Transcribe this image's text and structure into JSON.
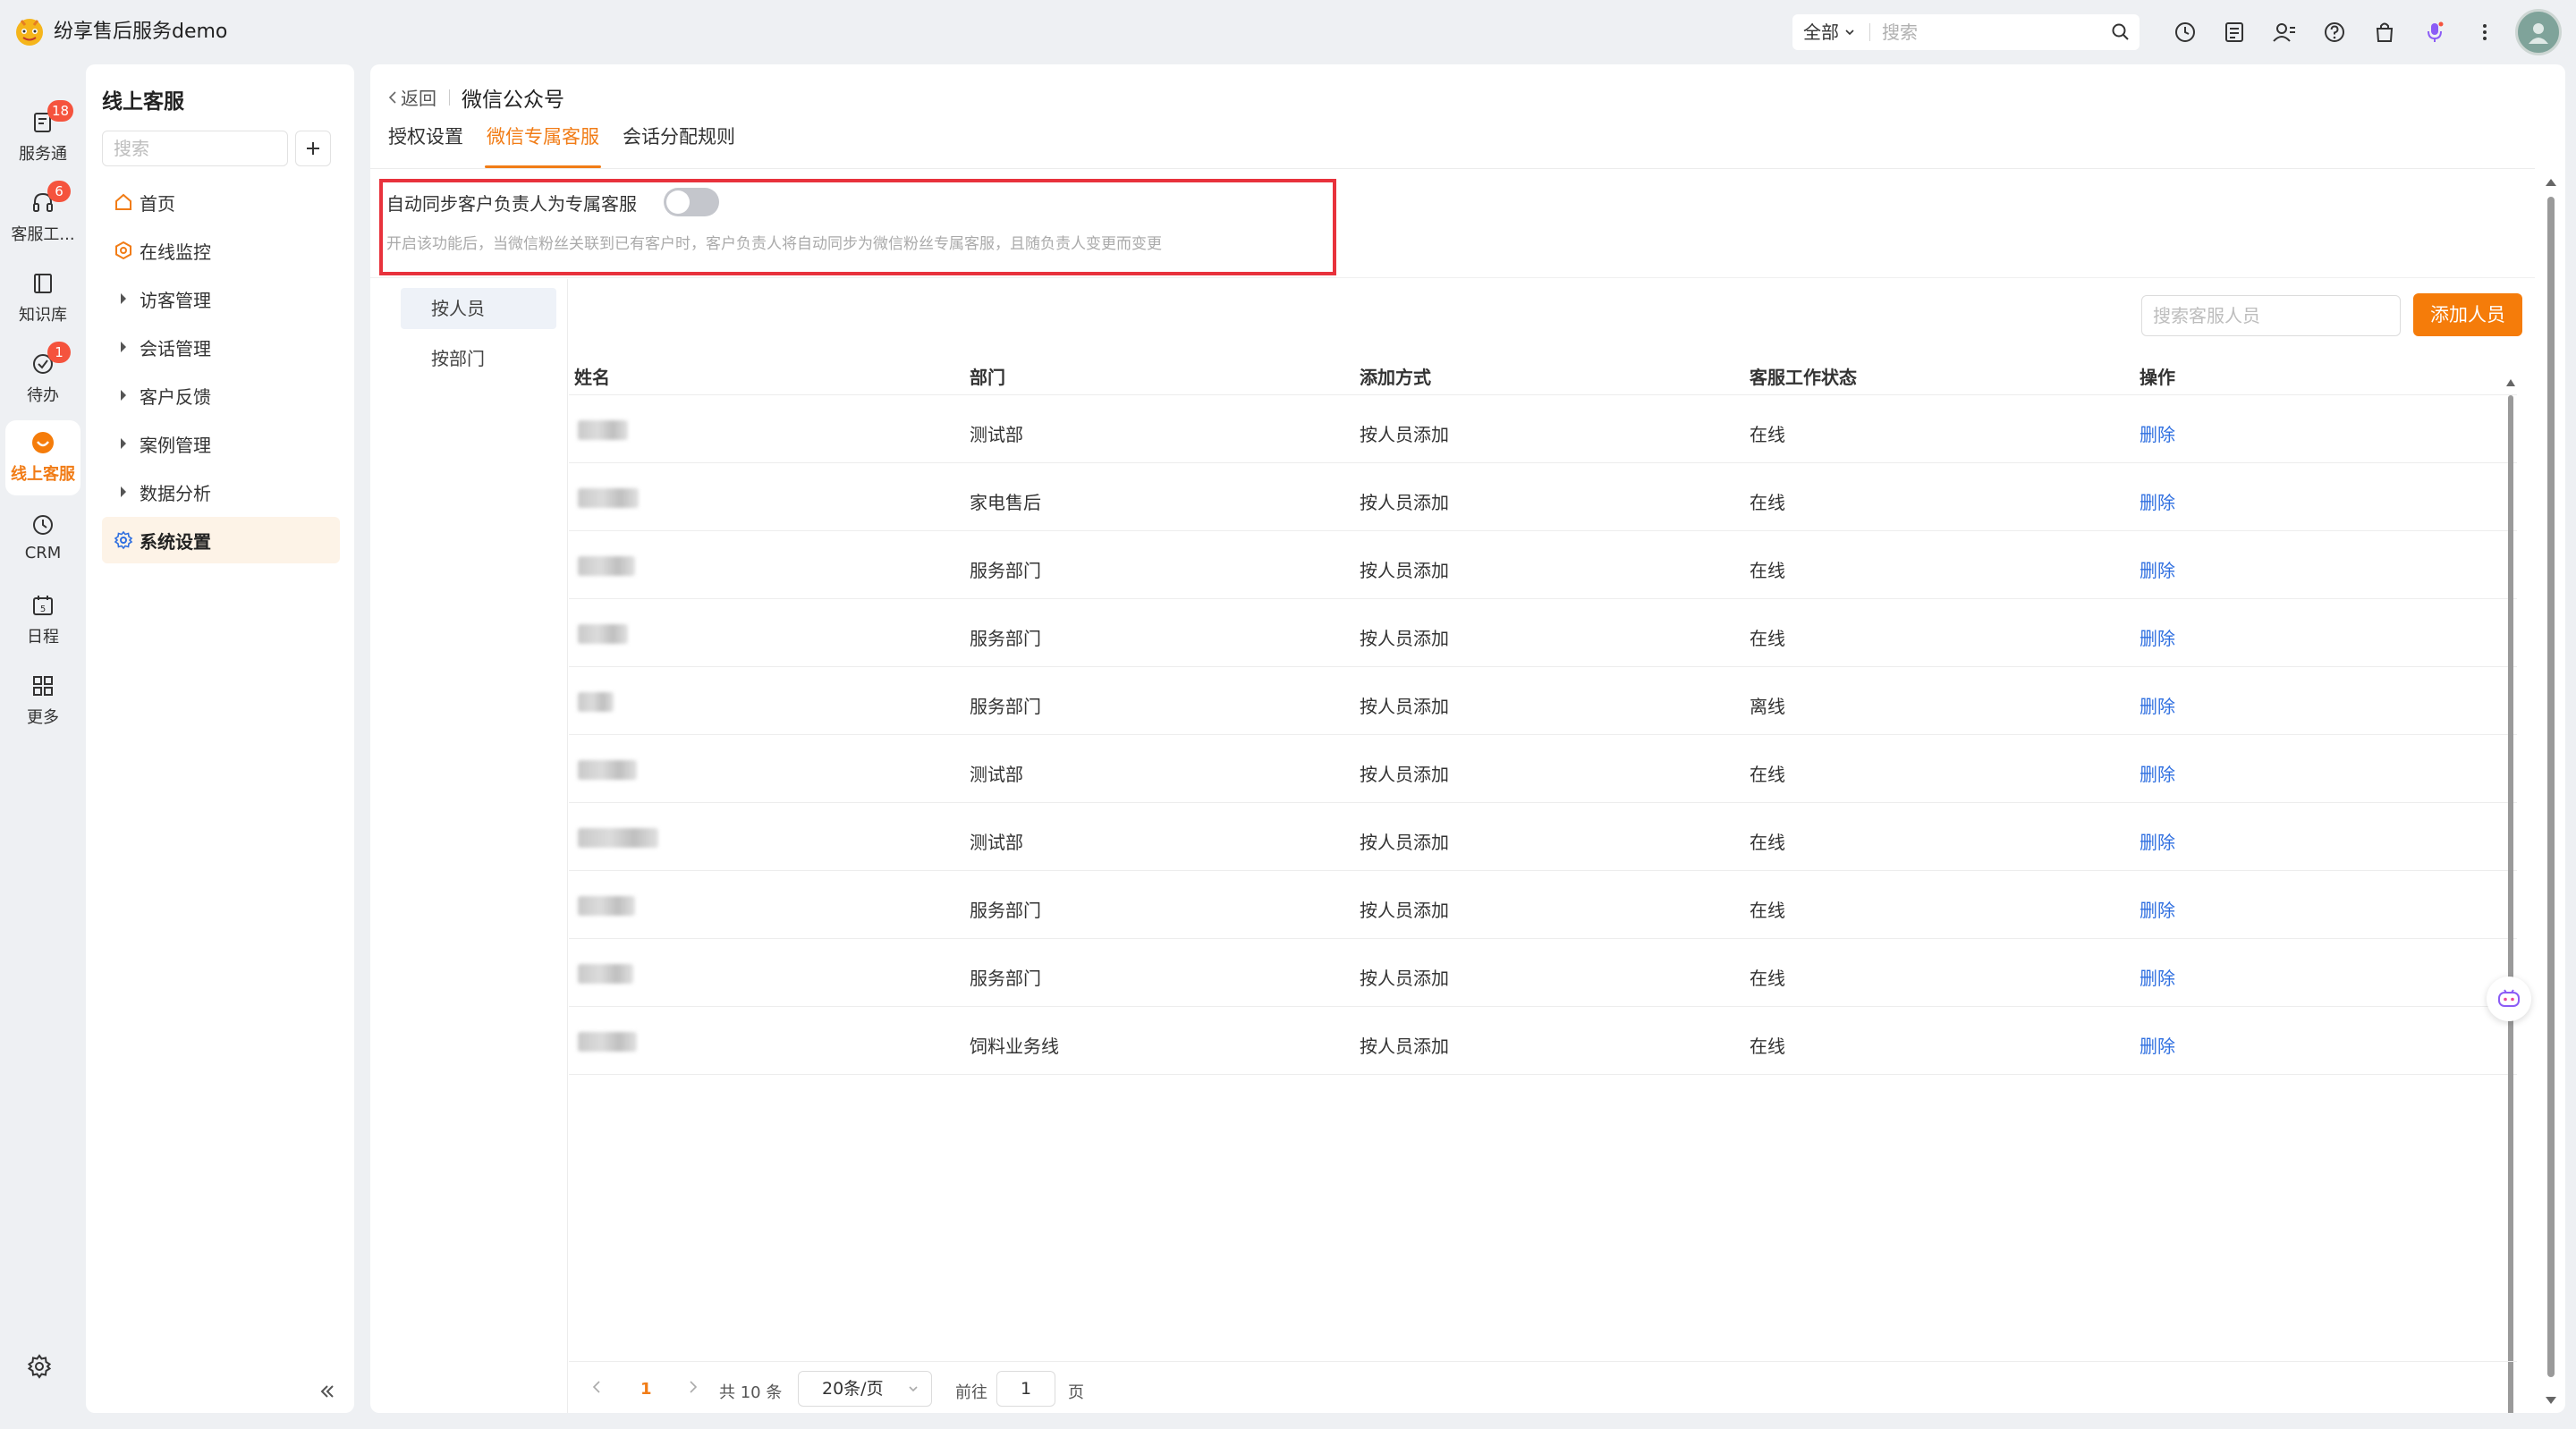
{
  "app": {
    "title": "纷享售后服务demo"
  },
  "topbar": {
    "scope": "全部",
    "search_placeholder": "搜索"
  },
  "rail": {
    "items": [
      {
        "label": "服务通",
        "badge": "18"
      },
      {
        "label": "客服工...",
        "badge": "6"
      },
      {
        "label": "知识库",
        "badge": ""
      },
      {
        "label": "待办",
        "badge": "1"
      },
      {
        "label": "线上客服",
        "badge": ""
      },
      {
        "label": "CRM",
        "badge": ""
      },
      {
        "label": "日程",
        "badge": ""
      },
      {
        "label": "更多",
        "badge": ""
      }
    ]
  },
  "subnav": {
    "title": "线上客服",
    "search_placeholder": "搜索",
    "items": [
      {
        "label": "首页"
      },
      {
        "label": "在线监控"
      },
      {
        "label": "访客管理"
      },
      {
        "label": "会话管理"
      },
      {
        "label": "客户反馈"
      },
      {
        "label": "案例管理"
      },
      {
        "label": "数据分析"
      },
      {
        "label": "系统设置"
      }
    ]
  },
  "main": {
    "back_label": "返回",
    "title": "微信公众号",
    "tabs": [
      {
        "label": "授权设置"
      },
      {
        "label": "微信专属客服"
      },
      {
        "label": "会话分配规则"
      }
    ],
    "sync": {
      "label": "自动同步客户负责人为专属客服",
      "enabled": false,
      "description": "开启该功能后，当微信粉丝关联到已有客户时，客户负责人将自动同步为微信粉丝专属客服，且随负责人变更而变更"
    },
    "side_tabs": [
      {
        "label": "按人员"
      },
      {
        "label": "按部门"
      }
    ],
    "staff_search_placeholder": "搜索客服人员",
    "add_staff_label": "添加人员",
    "table": {
      "headers": {
        "name": "姓名",
        "dept": "部门",
        "method": "添加方式",
        "status": "客服工作状态",
        "op": "操作"
      },
      "rows": [
        {
          "dept": "测试部",
          "method": "按人员添加",
          "status": "在线",
          "op": "删除"
        },
        {
          "dept": "家电售后",
          "method": "按人员添加",
          "status": "在线",
          "op": "删除"
        },
        {
          "dept": "服务部门",
          "method": "按人员添加",
          "status": "在线",
          "op": "删除"
        },
        {
          "dept": "服务部门",
          "method": "按人员添加",
          "status": "在线",
          "op": "删除"
        },
        {
          "dept": "服务部门",
          "method": "按人员添加",
          "status": "离线",
          "op": "删除"
        },
        {
          "dept": "测试部",
          "method": "按人员添加",
          "status": "在线",
          "op": "删除"
        },
        {
          "dept": "测试部",
          "method": "按人员添加",
          "status": "在线",
          "op": "删除"
        },
        {
          "dept": "服务部门",
          "method": "按人员添加",
          "status": "在线",
          "op": "删除"
        },
        {
          "dept": "服务部门",
          "method": "按人员添加",
          "status": "在线",
          "op": "删除"
        },
        {
          "dept": "饲料业务线",
          "method": "按人员添加",
          "status": "在线",
          "op": "删除"
        }
      ]
    },
    "pagination": {
      "current": "1",
      "total": "共 10 条",
      "page_size": "20条/页",
      "goto_prefix": "前往",
      "goto_value": "1",
      "goto_suffix": "页"
    }
  },
  "colors": {
    "accent": "#f17c16",
    "button": "#f57c0a",
    "link": "#2f6fe0",
    "badge": "#f5533d",
    "highlight": "#e8323c"
  }
}
